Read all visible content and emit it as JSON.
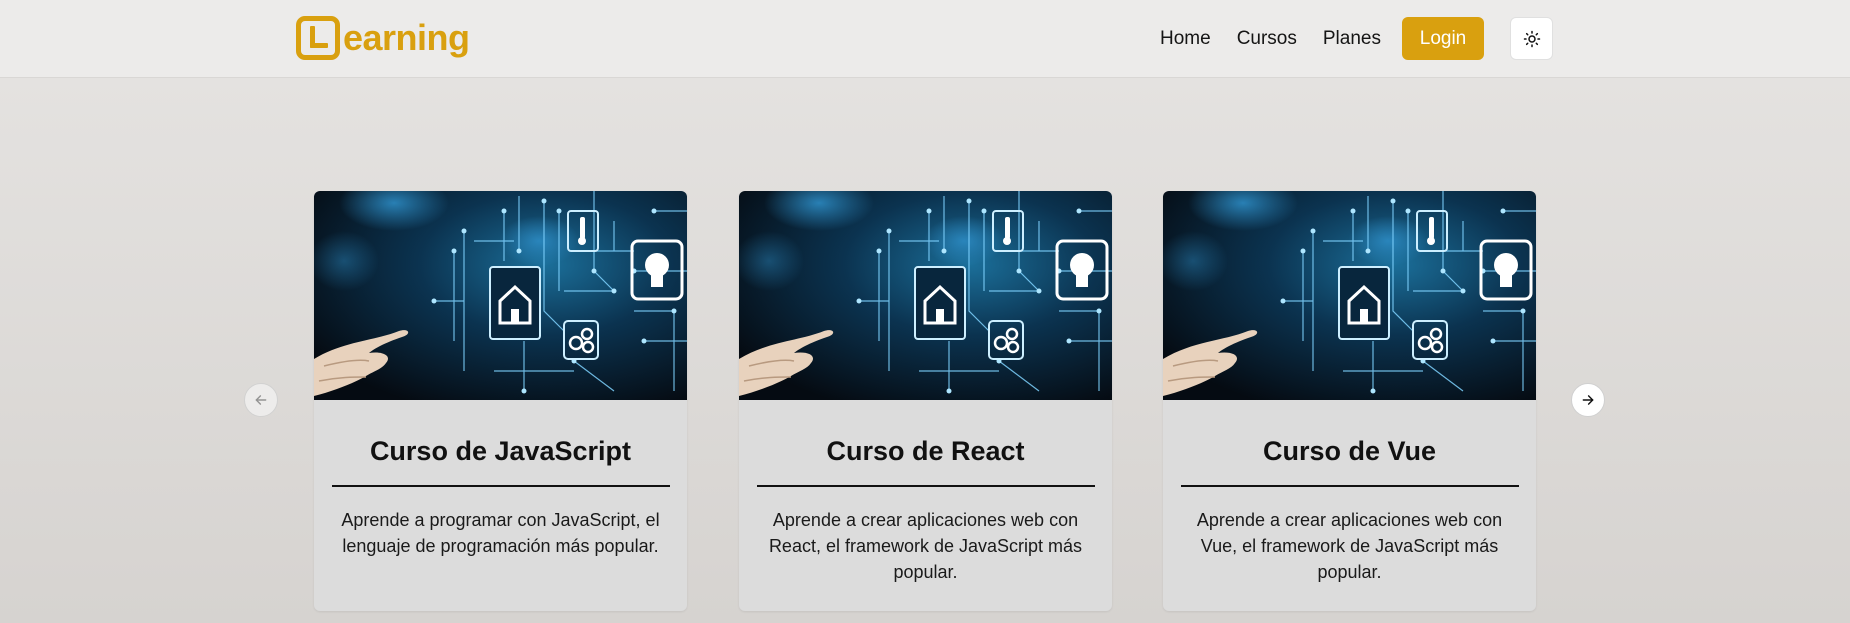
{
  "header": {
    "logo_text": "earning",
    "nav": [
      "Home",
      "Cursos",
      "Planes"
    ],
    "login_label": "Login"
  },
  "colors": {
    "accent": "#d9a00f",
    "card_bg": "#dcdcdc"
  },
  "courses": [
    {
      "title": "Curso de JavaScript",
      "description": "Aprende a programar con JavaScript, el lenguaje de programación más popular."
    },
    {
      "title": "Curso de React",
      "description": "Aprende a crear aplicaciones web con React, el framework de JavaScript más popular."
    },
    {
      "title": "Curso de Vue",
      "description": "Aprende a crear aplicaciones web con Vue, el framework de JavaScript más popular."
    }
  ]
}
